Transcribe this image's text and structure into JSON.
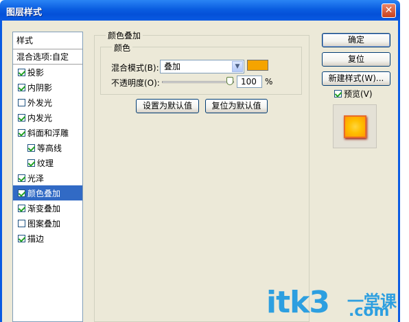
{
  "window": {
    "title": "图层样式",
    "close_glyph": "✕"
  },
  "style_list": {
    "header": "样式",
    "blend_options": "混合选项:自定",
    "items": [
      {
        "label": "投影",
        "checked": true,
        "indent": false,
        "selected": false
      },
      {
        "label": "内阴影",
        "checked": true,
        "indent": false,
        "selected": false
      },
      {
        "label": "外发光",
        "checked": false,
        "indent": false,
        "selected": false
      },
      {
        "label": "内发光",
        "checked": true,
        "indent": false,
        "selected": false
      },
      {
        "label": "斜面和浮雕",
        "checked": true,
        "indent": false,
        "selected": false
      },
      {
        "label": "等高线",
        "checked": true,
        "indent": true,
        "selected": false
      },
      {
        "label": "纹理",
        "checked": true,
        "indent": true,
        "selected": false
      },
      {
        "label": "光泽",
        "checked": true,
        "indent": false,
        "selected": false
      },
      {
        "label": "颜色叠加",
        "checked": true,
        "indent": false,
        "selected": true
      },
      {
        "label": "渐变叠加",
        "checked": true,
        "indent": false,
        "selected": false
      },
      {
        "label": "图案叠加",
        "checked": false,
        "indent": false,
        "selected": false
      },
      {
        "label": "描边",
        "checked": true,
        "indent": false,
        "selected": false
      }
    ]
  },
  "panel": {
    "title": "颜色叠加",
    "color_group": "颜色",
    "blend_mode_label": "混合模式(B):",
    "blend_mode_value": "叠加",
    "overlay_color": "#f5a400",
    "opacity_label": "不透明度(O):",
    "opacity_value": "100",
    "opacity_unit": "%",
    "opacity_slider": 1.0,
    "set_default": "设置为默认值",
    "reset_default": "复位为默认值"
  },
  "actions": {
    "ok": "确定",
    "reset": "复位",
    "new_style": "新建样式(W)...",
    "preview_label": "预览(V)",
    "preview_checked": true
  },
  "watermark": {
    "main": "itk3",
    "cn": "一堂课",
    "com": ".com"
  },
  "colors": {
    "title_bar": "#0a5be2",
    "selection": "#316ac5",
    "check": "#21a121"
  }
}
